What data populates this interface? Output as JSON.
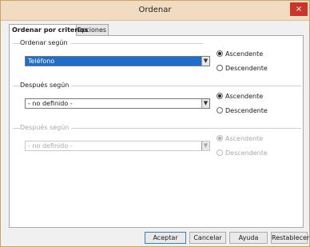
{
  "window": {
    "title": "Ordenar",
    "close": "×"
  },
  "tabs": [
    {
      "label": "Ordenar por criterios"
    },
    {
      "label": "Opciones"
    }
  ],
  "sections": [
    {
      "label": "Ordenar según",
      "combo_value": "Teléfono",
      "ascending": "Ascendente",
      "descending": "Descendente"
    },
    {
      "label": "Después según",
      "combo_value": "- no definido -",
      "ascending": "Ascendente",
      "descending": "Descendente"
    },
    {
      "label": "Después según",
      "combo_value": "- no definido -",
      "ascending": "Ascendente",
      "descending": "Descendente"
    }
  ],
  "buttons": {
    "accept": "Aceptar",
    "cancel": "Cancelar",
    "help": "Ayuda",
    "reset": "Restablecer"
  },
  "icons": {
    "dropdown": "chevron-down-icon"
  }
}
